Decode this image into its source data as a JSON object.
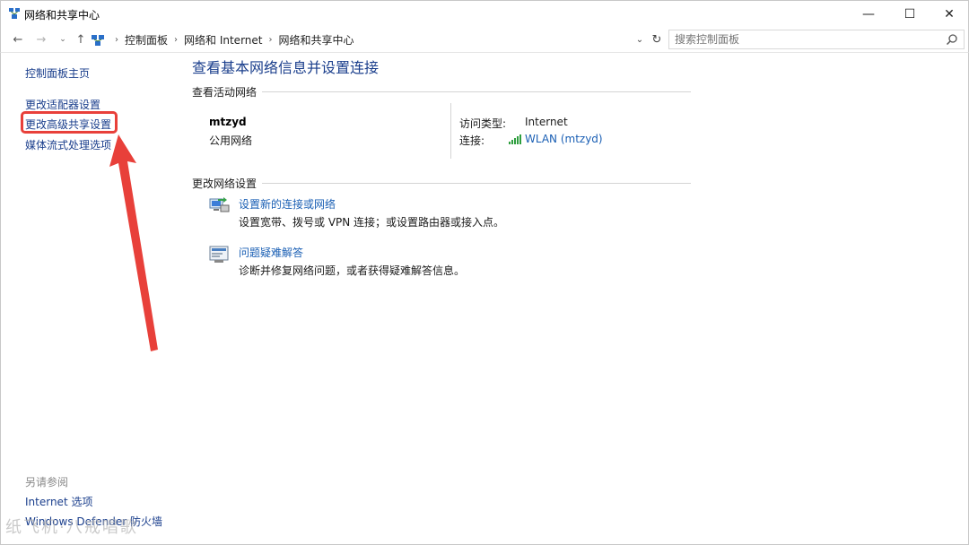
{
  "window": {
    "title": "网络和共享中心",
    "minimize": "—",
    "maximize": "☐",
    "close": "✕"
  },
  "address": {
    "back": "←",
    "forward": "→",
    "recent": "⌄",
    "up": "↑",
    "crumbs": [
      "控制面板",
      "网络和 Internet",
      "网络和共享中心"
    ],
    "separator": "›",
    "dropdown": "⌄",
    "refresh": "↻",
    "search_placeholder": "搜索控制面板"
  },
  "left_pane": {
    "home": "控制面板主页",
    "links": [
      "更改适配器设置",
      "更改高级共享设置",
      "媒体流式处理选项"
    ],
    "see_also_title": "另请参阅",
    "see_also": [
      "Internet 选项",
      "Windows Defender 防火墙"
    ]
  },
  "main": {
    "title": "查看基本网络信息并设置连接",
    "active_networks_heading": "查看活动网络",
    "network": {
      "name": "mtzyd",
      "type": "公用网络",
      "access_type_label": "访问类型:",
      "access_type_value": "Internet",
      "connection_label": "连接:",
      "connection_value": "WLAN (mtzyd)"
    },
    "change_settings_heading": "更改网络设置",
    "tasks": [
      {
        "title": "设置新的连接或网络",
        "desc": "设置宽带、拨号或 VPN 连接；或设置路由器或接入点。",
        "icon": "network-setup-icon"
      },
      {
        "title": "问题疑难解答",
        "desc": "诊断并修复网络问题，或者获得疑难解答信息。",
        "icon": "troubleshoot-icon"
      }
    ]
  },
  "annotation": {
    "color": "#e8403a"
  },
  "watermark": "纸飞机·八戒唱歌"
}
